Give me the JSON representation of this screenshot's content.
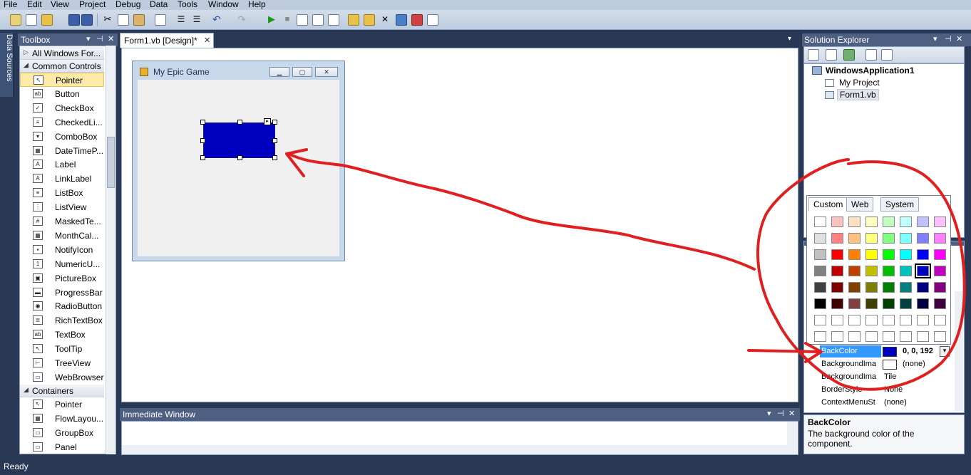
{
  "menu": [
    "File",
    "Edit",
    "View",
    "Project",
    "Debug",
    "Data",
    "Tools",
    "Window",
    "Help"
  ],
  "data_sources_label": "Data Sources",
  "toolbox": {
    "title": "Toolbox",
    "all_forms": "All Windows For...",
    "common_header": "Common Controls",
    "common_items": [
      {
        "label": "Pointer",
        "icon": "pointer-icon",
        "glyph": "↖"
      },
      {
        "label": "Button",
        "icon": "button-icon",
        "glyph": "ab"
      },
      {
        "label": "CheckBox",
        "icon": "checkbox-icon",
        "glyph": "✓"
      },
      {
        "label": "CheckedLi...",
        "icon": "checkedlistbox-icon",
        "glyph": "≡"
      },
      {
        "label": "ComboBox",
        "icon": "combobox-icon",
        "glyph": "▾"
      },
      {
        "label": "DateTimeP...",
        "icon": "datetimepicker-icon",
        "glyph": "▦"
      },
      {
        "label": "Label",
        "icon": "label-icon",
        "glyph": "A"
      },
      {
        "label": "LinkLabel",
        "icon": "linklabel-icon",
        "glyph": "A"
      },
      {
        "label": "ListBox",
        "icon": "listbox-icon",
        "glyph": "≡"
      },
      {
        "label": "ListView",
        "icon": "listview-icon",
        "glyph": "⋮"
      },
      {
        "label": "MaskedTe...",
        "icon": "maskedtextbox-icon",
        "glyph": "#"
      },
      {
        "label": "MonthCal...",
        "icon": "monthcalendar-icon",
        "glyph": "▦"
      },
      {
        "label": "NotifyIcon",
        "icon": "notifyicon-icon",
        "glyph": "▪"
      },
      {
        "label": "NumericU...",
        "icon": "numericupdown-icon",
        "glyph": "1"
      },
      {
        "label": "PictureBox",
        "icon": "picturebox-icon",
        "glyph": "▣"
      },
      {
        "label": "ProgressBar",
        "icon": "progressbar-icon",
        "glyph": "▬"
      },
      {
        "label": "RadioButton",
        "icon": "radiobutton-icon",
        "glyph": "◉"
      },
      {
        "label": "RichTextBox",
        "icon": "richtextbox-icon",
        "glyph": "≣"
      },
      {
        "label": "TextBox",
        "icon": "textbox-icon",
        "glyph": "ab"
      },
      {
        "label": "ToolTip",
        "icon": "tooltip-icon",
        "glyph": "↖"
      },
      {
        "label": "TreeView",
        "icon": "treeview-icon",
        "glyph": "⊢"
      },
      {
        "label": "WebBrowser",
        "icon": "webbrowser-icon",
        "glyph": "▭"
      }
    ],
    "containers_header": "Containers",
    "container_items": [
      {
        "label": "Pointer",
        "icon": "pointer-icon",
        "glyph": "↖"
      },
      {
        "label": "FlowLayou...",
        "icon": "flowlayoutpanel-icon",
        "glyph": "▦"
      },
      {
        "label": "GroupBox",
        "icon": "groupbox-icon",
        "glyph": "▭"
      },
      {
        "label": "Panel",
        "icon": "panel-icon",
        "glyph": "▭"
      }
    ]
  },
  "designer": {
    "tab_label": "Form1.vb [Design]*",
    "form_title": "My Epic Game",
    "box_color": "#0000c0"
  },
  "immediate": {
    "title": "Immediate Window"
  },
  "solution_explorer": {
    "title": "Solution Explorer",
    "root": "WindowsApplication1",
    "items": [
      "My Project",
      "Form1.vb"
    ]
  },
  "color_picker": {
    "tabs": [
      "Custom",
      "Web",
      "System"
    ],
    "selected_tab": "Custom",
    "swatches": [
      [
        "#ffffff",
        "#ffc0c0",
        "#ffe0c0",
        "#ffffc0",
        "#c0ffc0",
        "#c0ffff",
        "#c0c0ff",
        "#ffc0ff"
      ],
      [
        "#e0e0e0",
        "#ff8080",
        "#ffc080",
        "#ffff80",
        "#80ff80",
        "#80ffff",
        "#8080ff",
        "#ff80ff"
      ],
      [
        "#c0c0c0",
        "#ff0000",
        "#ff8000",
        "#ffff00",
        "#00ff00",
        "#00ffff",
        "#0000ff",
        "#ff00ff"
      ],
      [
        "#808080",
        "#c00000",
        "#c04000",
        "#c0c000",
        "#00c000",
        "#00c0c0",
        "#0000c0",
        "#c000c0"
      ],
      [
        "#404040",
        "#800000",
        "#804000",
        "#808000",
        "#008000",
        "#008080",
        "#000080",
        "#800080"
      ],
      [
        "#000000",
        "#400000",
        "#804040",
        "#404000",
        "#004000",
        "#004040",
        "#000040",
        "#400040"
      ],
      [
        "#ffffff",
        "#ffffff",
        "#ffffff",
        "#ffffff",
        "#ffffff",
        "#ffffff",
        "#ffffff",
        "#ffffff"
      ],
      [
        "#ffffff",
        "#ffffff",
        "#ffffff",
        "#ffffff",
        "#ffffff",
        "#ffffff",
        "#ffffff",
        "#ffffff"
      ]
    ],
    "selected_swatch": "#0000c0"
  },
  "properties": {
    "rows": [
      {
        "name": "BackColor",
        "value": "0, 0, 192",
        "swatch": "#0000c0",
        "selected": true
      },
      {
        "name": "BackgroundIma",
        "value": "(none)",
        "swatch": "#ffffff",
        "selected": false
      },
      {
        "name": "BackgroundIma",
        "value": "Tile",
        "swatch": "",
        "selected": false
      },
      {
        "name": "BorderStyle",
        "value": "None",
        "swatch": "",
        "selected": false
      },
      {
        "name": "ContextMenuSt",
        "value": "(none)",
        "swatch": "",
        "selected": false
      }
    ],
    "desc_title": "BackColor",
    "desc_text": "The background color of the component."
  },
  "status": "Ready"
}
